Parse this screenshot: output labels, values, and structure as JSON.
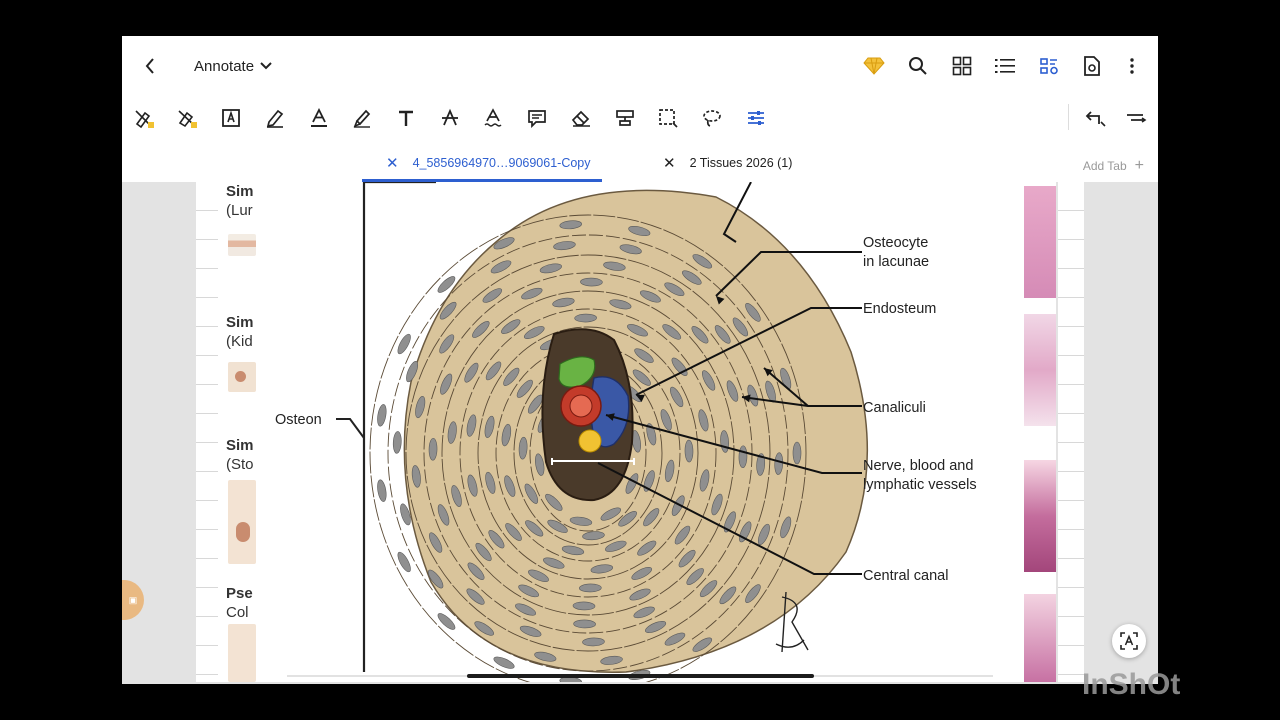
{
  "header": {
    "mode_label": "Annotate",
    "icons": [
      "back-icon",
      "chevron-down-icon",
      "premium-diamond-icon",
      "search-icon",
      "grid-icon",
      "list-icon",
      "reflow-icon",
      "doc-settings-icon",
      "more-icon"
    ]
  },
  "toolbar": {
    "tools": [
      "highlighter-eraser-icon",
      "eraser-highlight-icon",
      "text-box-icon",
      "pen-icon",
      "underline-text-icon",
      "marker-icon",
      "text-tool-icon",
      "strikethrough-icon",
      "squiggly-icon",
      "comment-icon",
      "eraser-icon",
      "stamp-icon",
      "select-area-icon",
      "lasso-icon",
      "tool-settings-icon"
    ],
    "right": [
      "undo-icon",
      "collapse-toolbar-icon"
    ],
    "accent": "#2d5fd0"
  },
  "tabs": {
    "items": [
      {
        "label": "4_5856964970…9069061-Copy",
        "active": true
      },
      {
        "label": "2 Tissues 2026 (1)",
        "active": false
      }
    ],
    "add_label": "Add Tab"
  },
  "document": {
    "left_labels": [
      {
        "bold": "Sim",
        "sub": "(Lur"
      },
      {
        "bold": "Sim",
        "sub": "(Kid"
      },
      {
        "bold": "Sim",
        "sub": "(Sto"
      },
      {
        "bold": "Pse",
        "sub": "Col"
      }
    ],
    "diagram_labels": {
      "osteon": "Osteon",
      "osteocyte_1": "Osteocyte",
      "osteocyte_2": "in lacunae",
      "endosteum": "Endosteum",
      "canaliculi": "Canaliculi",
      "vessels_1": "Nerve, blood and",
      "vessels_2": "lymphatic vessels",
      "central_canal": "Central canal"
    },
    "colors": {
      "bone": "#d9c49b",
      "lamella_line": "#5a4a35",
      "lacuna": "#8f8f8f",
      "canal": "#4a3a2a"
    }
  },
  "watermark": "InShOt"
}
